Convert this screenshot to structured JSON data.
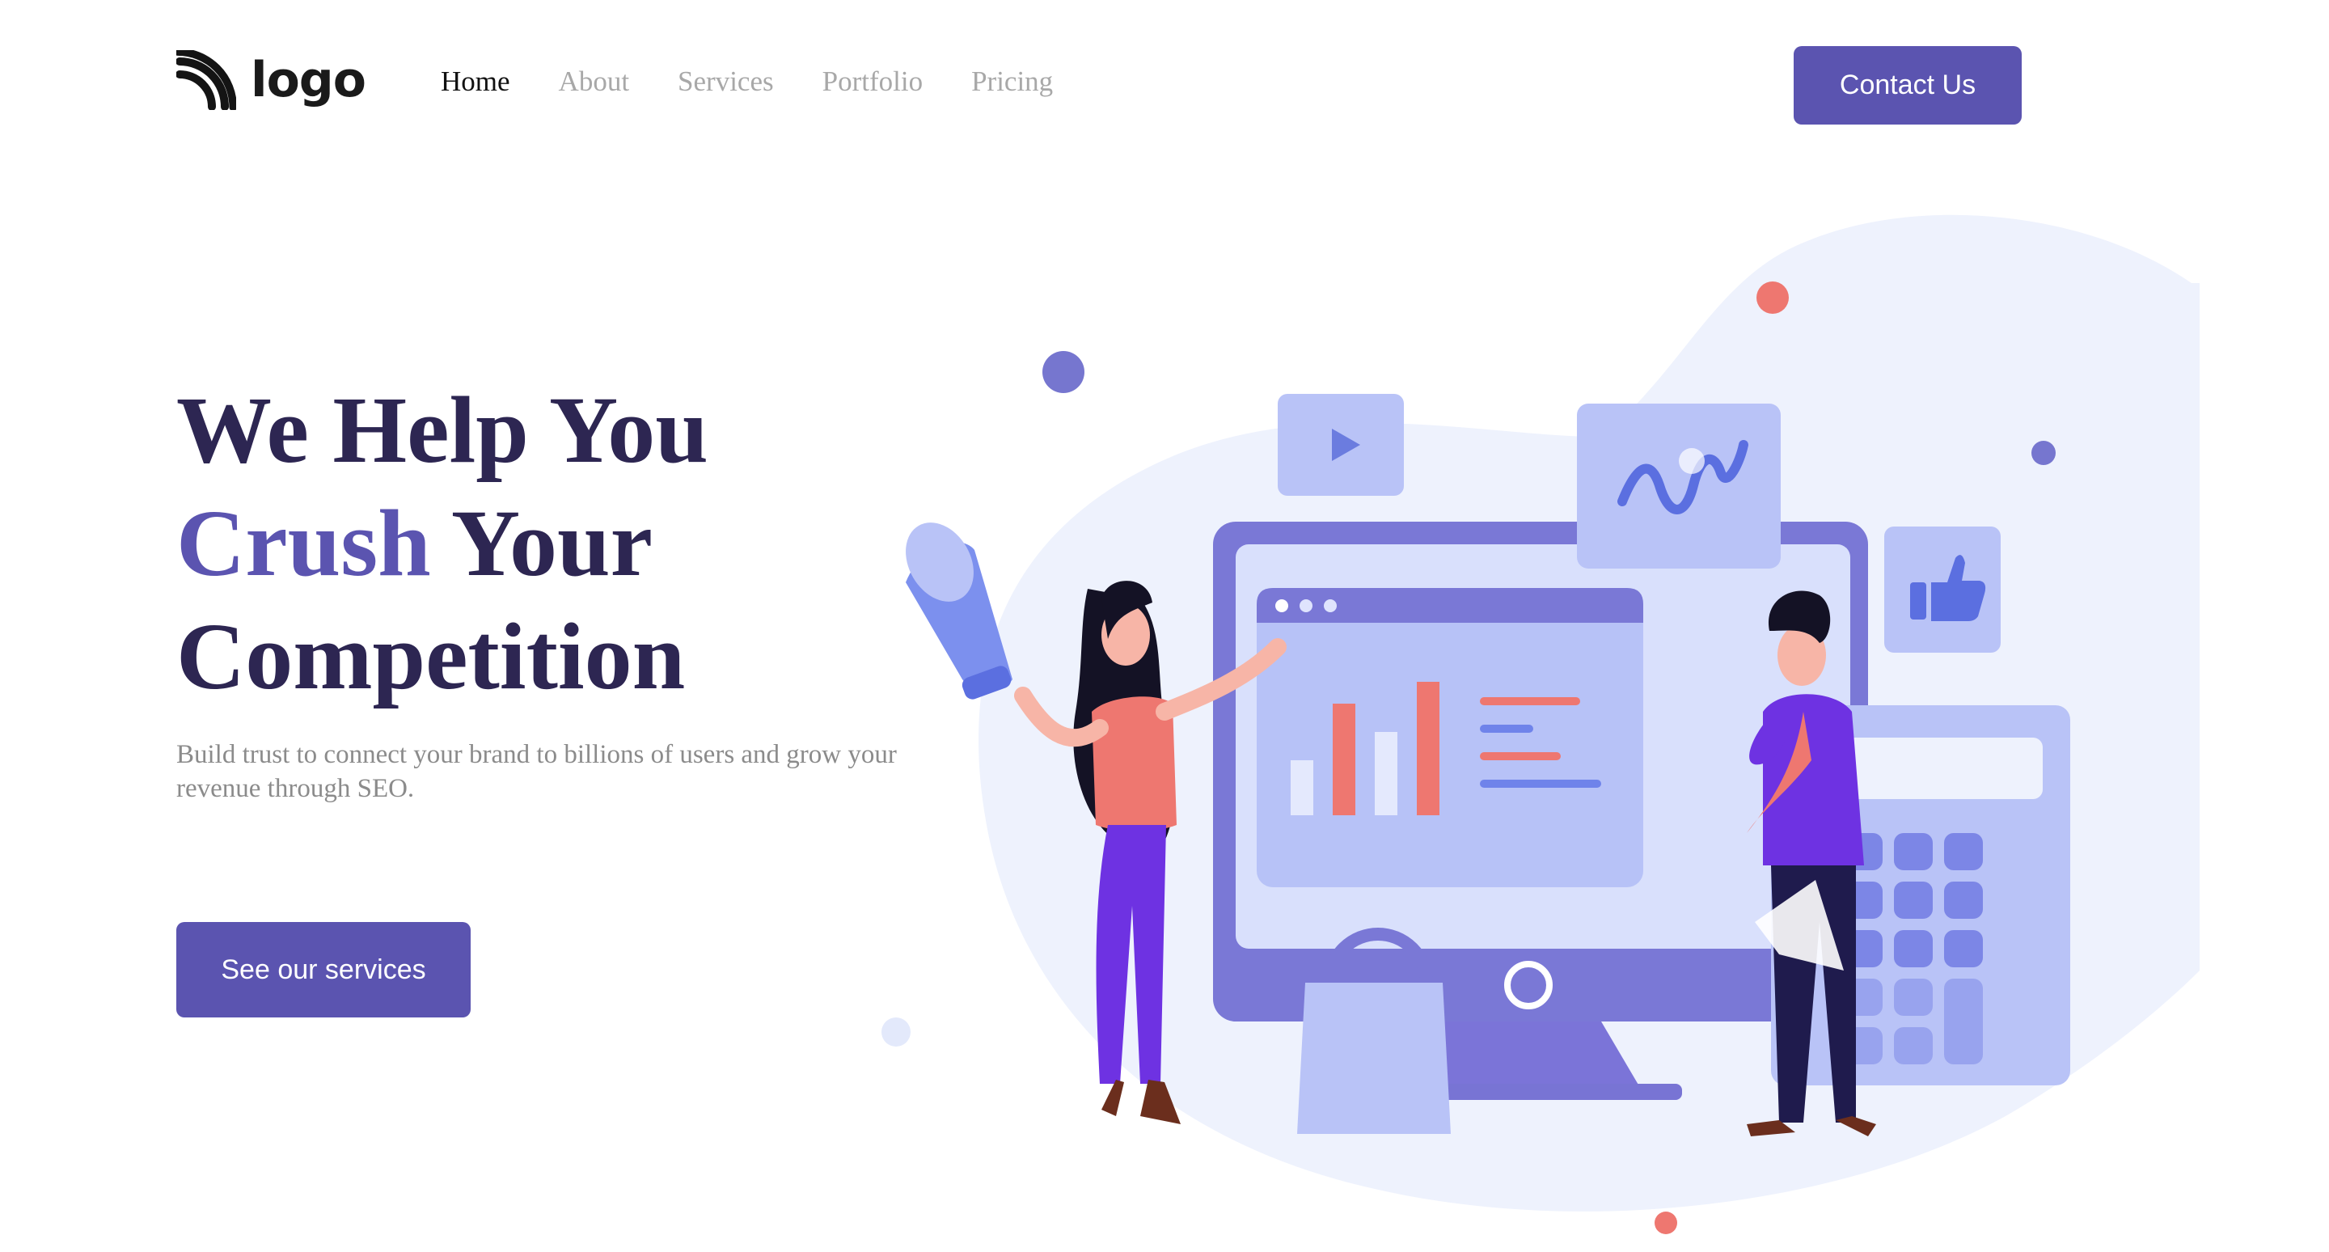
{
  "header": {
    "logo_text": "logo",
    "nav": [
      {
        "label": "Home",
        "active": true
      },
      {
        "label": "About",
        "active": false
      },
      {
        "label": "Services",
        "active": false
      },
      {
        "label": "Portfolio",
        "active": false
      },
      {
        "label": "Pricing",
        "active": false
      }
    ],
    "contact_label": "Contact Us"
  },
  "hero": {
    "title_line1": "We Help You",
    "title_accent": "Crush",
    "title_line2_rest": " Your",
    "title_line3": "Competition",
    "subtitle": "Build trust to connect your brand to billions of users and grow your revenue through SEO.",
    "cta_label": "See our services"
  },
  "illustration": {
    "icons": [
      "megaphone-icon",
      "play-icon",
      "line-chart-icon",
      "thumbs-up-icon",
      "calculator-icon",
      "shopping-bag-icon",
      "bar-chart-icon"
    ]
  },
  "colors": {
    "accent": "#5b54b0",
    "title": "#2d2652",
    "muted_text": "#8b8b8b",
    "nav_inactive": "#a8a8a8",
    "blob": "#eef2fd",
    "coral": "#ee7770",
    "lavender": "#b9c3f7"
  }
}
